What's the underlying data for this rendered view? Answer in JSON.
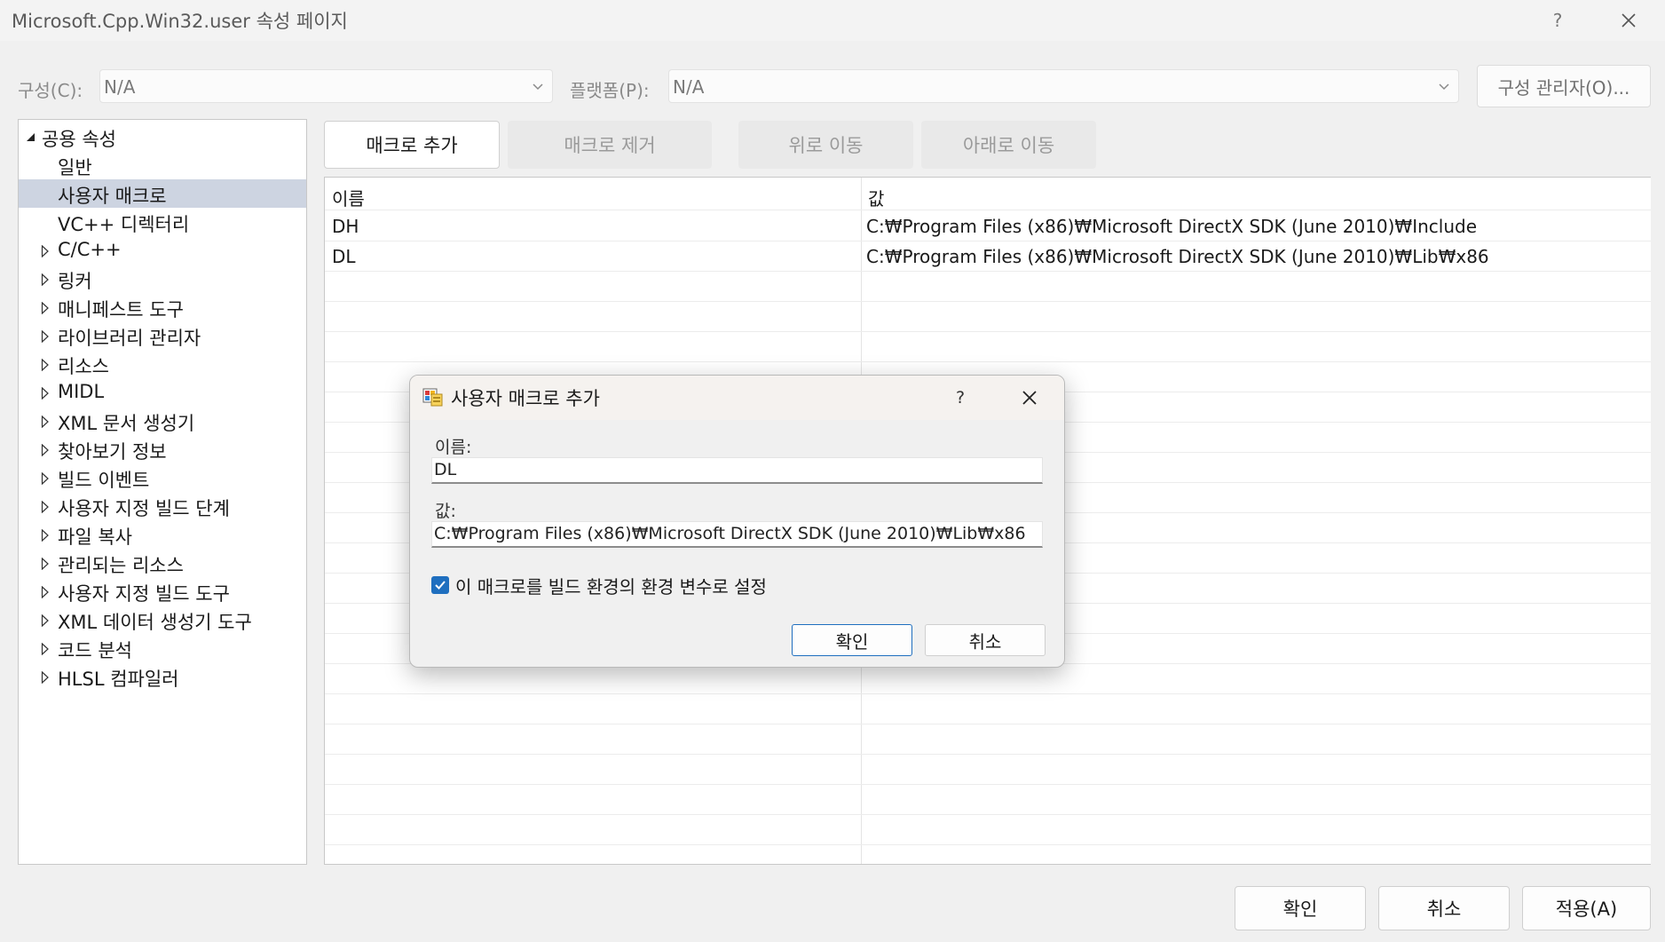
{
  "window": {
    "title": "Microsoft.Cpp.Win32.user 속성 페이지",
    "help_glyph": "?",
    "close_icon": "close-icon"
  },
  "config_row": {
    "config_label": "구성(C):",
    "config_value": "N/A",
    "platform_label": "플랫폼(P):",
    "platform_value": "N/A",
    "config_manager_label": "구성 관리자(O)..."
  },
  "tree": {
    "root": "공용 속성",
    "items": [
      {
        "label": "일반",
        "expandable": false,
        "selected": false
      },
      {
        "label": "사용자 매크로",
        "expandable": false,
        "selected": true
      },
      {
        "label": "VC++ 디렉터리",
        "expandable": false,
        "selected": false
      },
      {
        "label": "C/C++",
        "expandable": true,
        "selected": false
      },
      {
        "label": "링커",
        "expandable": true,
        "selected": false
      },
      {
        "label": "매니페스트 도구",
        "expandable": true,
        "selected": false
      },
      {
        "label": "라이브러리 관리자",
        "expandable": true,
        "selected": false
      },
      {
        "label": "리소스",
        "expandable": true,
        "selected": false
      },
      {
        "label": "MIDL",
        "expandable": true,
        "selected": false
      },
      {
        "label": "XML 문서 생성기",
        "expandable": true,
        "selected": false
      },
      {
        "label": "찾아보기 정보",
        "expandable": true,
        "selected": false
      },
      {
        "label": "빌드 이벤트",
        "expandable": true,
        "selected": false
      },
      {
        "label": "사용자 지정 빌드 단계",
        "expandable": true,
        "selected": false
      },
      {
        "label": "파일 복사",
        "expandable": true,
        "selected": false
      },
      {
        "label": "관리되는 리소스",
        "expandable": true,
        "selected": false
      },
      {
        "label": "사용자 지정 빌드 도구",
        "expandable": true,
        "selected": false
      },
      {
        "label": "XML 데이터 생성기 도구",
        "expandable": true,
        "selected": false
      },
      {
        "label": "코드 분석",
        "expandable": true,
        "selected": false
      },
      {
        "label": "HLSL 컴파일러",
        "expandable": true,
        "selected": false
      }
    ]
  },
  "toolbar": {
    "add_macro": "매크로 추가",
    "remove_macro": "매크로 제거",
    "move_up": "위로 이동",
    "move_down": "아래로 이동"
  },
  "grid": {
    "columns": [
      "이름",
      "값"
    ],
    "rows": [
      {
        "name": "DH",
        "value": "C:₩Program Files (x86)₩Microsoft DirectX SDK (June 2010)₩Include"
      },
      {
        "name": "DL",
        "value": "C:₩Program Files (x86)₩Microsoft DirectX SDK (June 2010)₩Lib₩x86"
      }
    ]
  },
  "bottom_buttons": {
    "ok": "확인",
    "cancel": "취소",
    "apply": "적용(A)"
  },
  "modal": {
    "title": "사용자 매크로 추가",
    "help_glyph": "?",
    "name_label": "이름:",
    "name_value": "DL",
    "value_label": "값:",
    "value_value": "C:₩Program Files (x86)₩Microsoft DirectX SDK (June 2010)₩Lib₩x86",
    "checkbox_label": "이 매크로를 빌드 환경의 환경 변수로 설정",
    "checkbox_checked": true,
    "ok": "확인",
    "cancel": "취소"
  },
  "colors": {
    "accent": "#1f6fbf",
    "selection": "#cdd4e1"
  }
}
